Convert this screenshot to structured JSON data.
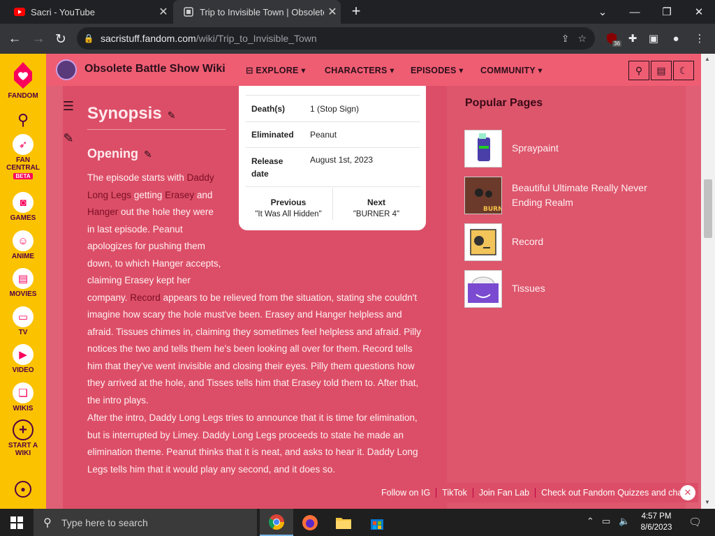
{
  "browser": {
    "tabs": [
      {
        "title": "Sacri - YouTube",
        "active": false
      },
      {
        "title": "Trip to Invisible Town | Obsolete Battle Show Wiki",
        "active": true
      }
    ],
    "url_host": "sacristuff.fandom.com",
    "url_path": "/wiki/Trip_to_Invisible_Town",
    "extension_badge": "36"
  },
  "fandom_rail": {
    "brand": "FANDOM",
    "items": [
      {
        "icon": "search-icon",
        "label": ""
      },
      {
        "icon": "fan-central-icon",
        "label": "FAN CENTRAL",
        "badge": "BETA"
      },
      {
        "icon": "games-icon",
        "label": "GAMES"
      },
      {
        "icon": "anime-icon",
        "label": "ANIME"
      },
      {
        "icon": "movies-icon",
        "label": "MOVIES"
      },
      {
        "icon": "tv-icon",
        "label": "TV"
      },
      {
        "icon": "video-icon",
        "label": "VIDEO"
      },
      {
        "icon": "wikis-icon",
        "label": "WIKIS"
      },
      {
        "icon": "start-a-wiki-icon",
        "label": "START A WIKI"
      }
    ]
  },
  "site_header": {
    "wiki_name": "Obsolete Battle Show Wiki",
    "nav": [
      "EXPLORE",
      "CHARACTERS",
      "EPISODES",
      "COMMUNITY"
    ]
  },
  "infobox": {
    "rows": [
      {
        "label": "Death(s)",
        "value": "1 (Stop Sign)"
      },
      {
        "label": "Eliminated",
        "value": "Peanut"
      },
      {
        "label": "Release date",
        "value": "August 1st, 2023"
      }
    ],
    "previous_label": "Previous",
    "previous_value": "\"It Was All Hidden\"",
    "next_label": "Next",
    "next_value": "\"BURNER 4\""
  },
  "article": {
    "heading": "Synopsis",
    "subheading": "Opening",
    "p1": {
      "t1": "The episode starts with ",
      "l1": "Daddy Long Legs",
      "t2": " getting ",
      "l2": "Erasey",
      "t3": " and ",
      "l3": "Hanger",
      "t4": " out the hole they were in last episode. Peanut apologizes for pushing them down, to which Hanger accepts, claiming Erasey kept her company. ",
      "l4": "Record",
      "t5": " appears to be relieved from the situation, stating she couldn't imagine how scary the hole must've been. Erasey and Hanger helpless and afraid. Tissues chimes in, claiming they sometimes feel helpless and afraid. Pilly notices the two and tells them he's been looking all over for them. Record tells him that they've went invisible and closing their eyes. Pilly them questions how they arrived at the hole, and Tisses tells him that Erasey told them to. After that, the intro plays."
    },
    "p2": "After the intro, Daddy Long Legs tries to announce that it is time for elimination, but is interrupted by Limey. Daddy Long Legs proceeds to state he made an elimination theme. Peanut thinks that it is neat, and asks to hear it. Daddy Long Legs tells him that it would play any second, and it does so."
  },
  "popular_pages": {
    "title": "Popular Pages",
    "items": [
      {
        "label": "Spraypaint"
      },
      {
        "label": "Beautiful Ultimate Really Never Ending Realm"
      },
      {
        "label": "Record"
      },
      {
        "label": "Tissues"
      }
    ]
  },
  "bottom_bar": [
    "Follow on IG",
    "TikTok",
    "Join Fan Lab",
    "Check out Fandom Quizzes and cha"
  ],
  "taskbar": {
    "search_placeholder": "Type here to search",
    "time": "4:57 PM",
    "date": "8/6/2023"
  },
  "colors": {
    "fandom_yellow": "#fbc200",
    "header_pink": "#ef5d73",
    "content_pink": "#dc4e67"
  }
}
